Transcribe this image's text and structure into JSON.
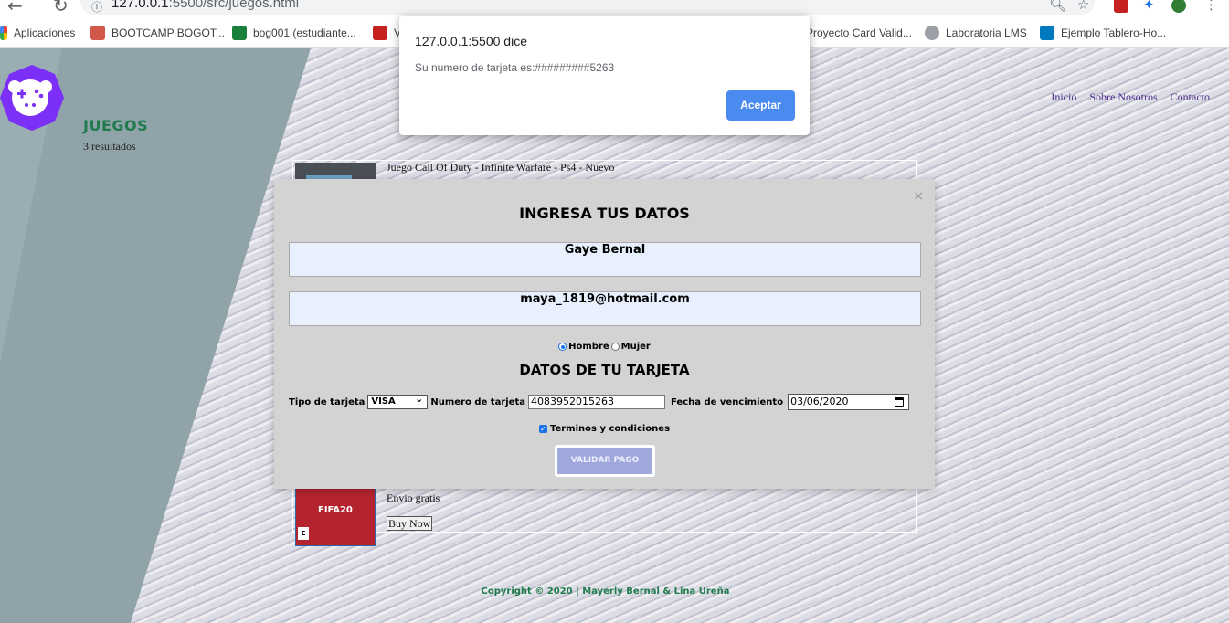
{
  "browser": {
    "url_host": "127.0.0.1",
    "url_rest": ":5500/src/juegos.html",
    "bookmarks": [
      {
        "label": "Aplicaciones",
        "icon": "apps-grid-icon",
        "color": "#4285f4"
      },
      {
        "label": "BOOTCAMP BOGOT...",
        "icon": "bootcamp-icon",
        "color": "#d2584a"
      },
      {
        "label": "bog001 (estudiante...",
        "icon": "classroom-icon",
        "color": "#188038"
      },
      {
        "label": "V",
        "icon": "page-icon",
        "color": "#c5221f"
      },
      {
        "label": "Proyecto Card Valid...",
        "icon": "page-icon",
        "color": "#4285f4"
      },
      {
        "label": "Laboratoria LMS",
        "icon": "globe-icon",
        "color": "#5f6368"
      },
      {
        "label": "Ejemplo Tablero-Ho...",
        "icon": "trello-icon",
        "color": "#0079bf"
      }
    ]
  },
  "alert": {
    "title": "127.0.0.1:5500 dice",
    "message": "Su numero de tarjeta es:#########5263",
    "ok_label": "Aceptar"
  },
  "header": {
    "section_title": "JUEGOS",
    "result_count": "3 resultados",
    "nav": [
      "Inicio",
      "Sobre Nosotros",
      "Contacto"
    ]
  },
  "products": [
    {
      "title": "Juego Call Of Duty - Infinite Warfare - Ps4 - Nuevo"
    },
    {
      "shipping": "Envio gratis",
      "buy_label": "Buy Now",
      "thumb_brand": "FIFA20",
      "thumb_rating": "E"
    }
  ],
  "modal": {
    "close": "×",
    "title": "INGRESA TUS DATOS",
    "name_value": "Gaye Bernal",
    "email_value": "maya_1819@hotmail.com",
    "gender_options": [
      "Hombre",
      "Mujer"
    ],
    "gender_selected": "Hombre",
    "subtitle": "DATOS DE TU TARJETA",
    "card_type_label": "Tipo de tarjeta",
    "card_type_value": "VISA",
    "card_number_label": "Numero de tarjeta",
    "card_number_value": "4083952015263",
    "expiry_label": "Fecha de vencimiento",
    "expiry_value": "03/06/2020",
    "terms_label": "Terminos y condiciones",
    "terms_checked": true,
    "submit_label": "VALIDAR PAGO"
  },
  "footer": {
    "copyright": "Copyright © 2020 | Mayerly Bernal & Lina Ureña"
  },
  "colors": {
    "accent_green": "#1f7a4c",
    "nav_purple": "#4b2a8c",
    "logo_purple": "#7b2ff7",
    "button_blue": "#4a8bf0",
    "pay_button": "#9fa8da"
  }
}
